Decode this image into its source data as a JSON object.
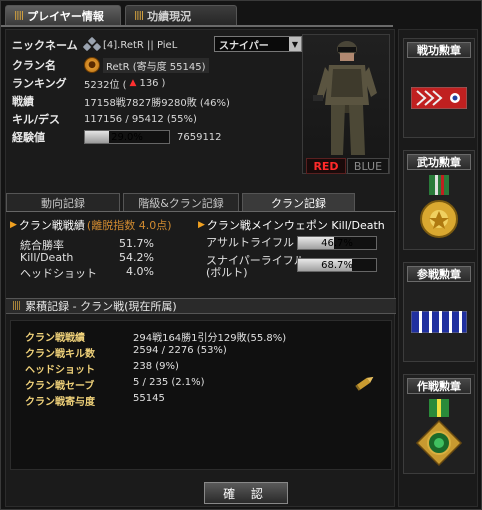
{
  "tabs": {
    "player_info": "プレイヤー情報",
    "achievements": "功績現況"
  },
  "player": {
    "nickname_label": "ニックネーム",
    "nickname": "[4].RetR || PieL",
    "role_select": "スナイパー",
    "clan_label": "クラン名",
    "clan_name": "RetR (寄与度 55145)",
    "ranking_label": "ランキング",
    "ranking_value": "5232位 (",
    "ranking_change": "136",
    "ranking_close": ")",
    "record_label": "戦績",
    "record_value": "17158戦7827勝9280敗 (46%)",
    "kd_label": "キル/デス",
    "kd_value": "117156 / 95412 (55%)",
    "exp_label": "経験値",
    "exp_percent_text": "29.0%",
    "exp_percent": 29.0,
    "exp_value": "7659112",
    "team_red": "RED",
    "team_blue": "BLUE"
  },
  "sub_tabs": {
    "tab1": "動向記録",
    "tab2": "階級&クラン記録",
    "tab3": "クラン記録"
  },
  "clan_battle": {
    "title": "クラン戦戦績",
    "subtitle": "(離脱指数 4.0点)",
    "win_rate_label": "統合勝率",
    "win_rate": "51.7%",
    "kd_label": "Kill/Death",
    "kd": "54.2%",
    "headshot_label": "ヘッドショット",
    "headshot": "4.0%"
  },
  "main_weapon": {
    "title": "クラン戦メインウェポン Kill/Death",
    "weapons": [
      {
        "label": "アサルトライフル",
        "text": "46.7%",
        "percent": 46.7
      },
      {
        "label": "スナイパーライフル\n(ボルト)",
        "text": "68.7%",
        "percent": 68.7
      }
    ]
  },
  "cumulative": {
    "header": "累積記録 - クラン戦(現在所属)",
    "rows": [
      {
        "label": "クラン戦戦績",
        "value": "294戦164勝1引分129敗(55.8%)"
      },
      {
        "label": "クラン戦キル数",
        "value": "2594 / 2276 (53%)"
      },
      {
        "label": "ヘッドショット",
        "value": "238 (9%)"
      },
      {
        "label": "クラン戦セーブ",
        "value": "5 / 235 (2.1%)"
      },
      {
        "label": "クラン戦寄与度",
        "value": "55145"
      }
    ]
  },
  "confirm_button": "確 認",
  "medals": [
    {
      "title": "戦功勲章",
      "icon": "service-ribbon-icon"
    },
    {
      "title": "武功勲章",
      "icon": "gold-medal-icon"
    },
    {
      "title": "参戦勲章",
      "icon": "blue-ribbon-icon"
    },
    {
      "title": "作戦勲章",
      "icon": "green-medal-icon"
    }
  ],
  "colors": {
    "accent_orange": "#f0a020",
    "red_team": "#ff2a2a",
    "gold_label": "#f0d27a"
  }
}
